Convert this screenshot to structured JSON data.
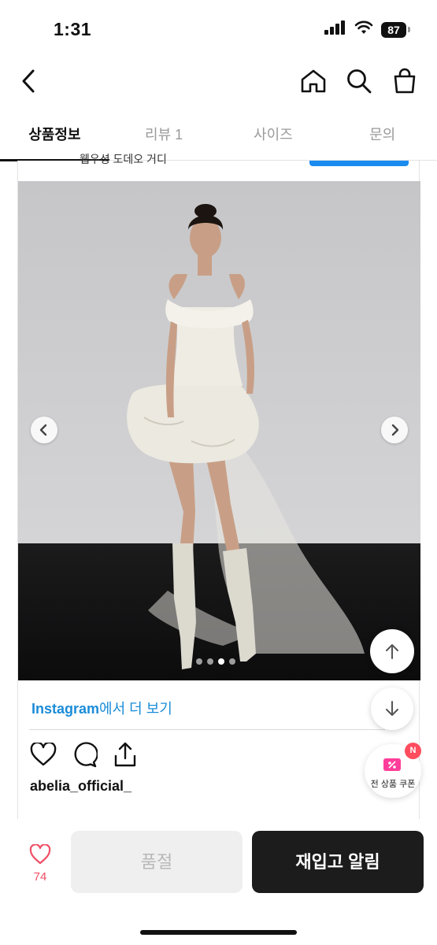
{
  "status_bar": {
    "time": "1:31",
    "battery": "87"
  },
  "nav": {
    "back_icon": "chevron-left-icon",
    "icons": [
      "home-icon",
      "search-icon",
      "shopping-bag-icon"
    ]
  },
  "tabs": [
    {
      "label": "상품정보",
      "active": true
    },
    {
      "label": "리뷰 1",
      "active": false
    },
    {
      "label": "사이즈",
      "active": false
    },
    {
      "label": "문의",
      "active": false
    }
  ],
  "embed": {
    "top_text": "웹우셩 도데오 거디",
    "photo": {
      "slide_count": 4,
      "active_slide": 3
    },
    "instagram_link": {
      "brand": "Instagram",
      "rest": "에서 더 보기"
    },
    "username": "abelia_official_"
  },
  "floating": {
    "coupon_label": "전 상품 쿠폰",
    "coupon_badge": "N"
  },
  "bottom_bar": {
    "like_count": "74",
    "soldout_label": "품절",
    "restock_label": "재입고 알림"
  },
  "colors": {
    "accent_blue": "#1a8cd8",
    "like_red": "#ef4f65",
    "cta_dark": "#1c1c1c",
    "badge_red": "#ff4d5e"
  }
}
